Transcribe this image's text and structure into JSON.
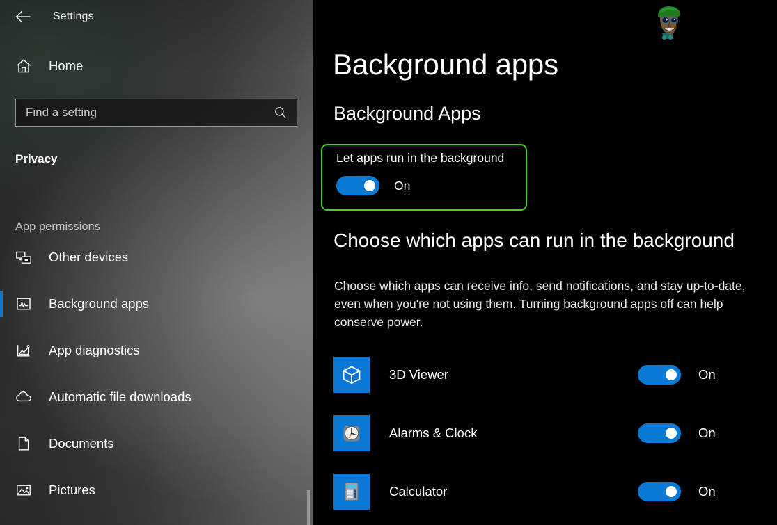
{
  "window": {
    "title": "Settings",
    "back_icon": "back-arrow-icon"
  },
  "sidebar": {
    "home": {
      "label": "Home",
      "icon": "home-icon"
    },
    "search": {
      "value": "",
      "placeholder": "Find a setting",
      "icon": "search-icon"
    },
    "category": "Privacy",
    "group_heading": "App permissions",
    "items": [
      {
        "label": "Other devices",
        "icon": "other-devices-icon",
        "selected": false
      },
      {
        "label": "Background apps",
        "icon": "background-apps-icon",
        "selected": true
      },
      {
        "label": "App diagnostics",
        "icon": "app-diagnostics-icon",
        "selected": false
      },
      {
        "label": "Automatic file downloads",
        "icon": "cloud-download-icon",
        "selected": false
      },
      {
        "label": "Documents",
        "icon": "document-icon",
        "selected": false
      },
      {
        "label": "Pictures",
        "icon": "pictures-icon",
        "selected": false
      }
    ]
  },
  "main": {
    "page_title": "Background apps",
    "section_title": "Background Apps",
    "master_toggle": {
      "label": "Let apps run in the background",
      "state": "On",
      "highlighted": true,
      "highlight_color": "#3fd51b"
    },
    "choose_heading": "Choose which apps can run in the background",
    "choose_description": "Choose which apps can receive info, send notifications, and stay up-to-date, even when you're not using them. Turning background apps off can help conserve power.",
    "apps": [
      {
        "name": "3D Viewer",
        "icon": "cube-3d-icon",
        "state": "On"
      },
      {
        "name": "Alarms & Clock",
        "icon": "alarm-clock-icon",
        "state": "On"
      },
      {
        "name": "Calculator",
        "icon": "calculator-icon",
        "state": "On"
      }
    ],
    "watermark": "cartoon-face-logo"
  },
  "colors": {
    "accent_blue": "#0b7ad4",
    "highlight_green": "#3fd51b",
    "main_bg": "#000000",
    "selection_bar": "#0b7ad4"
  }
}
